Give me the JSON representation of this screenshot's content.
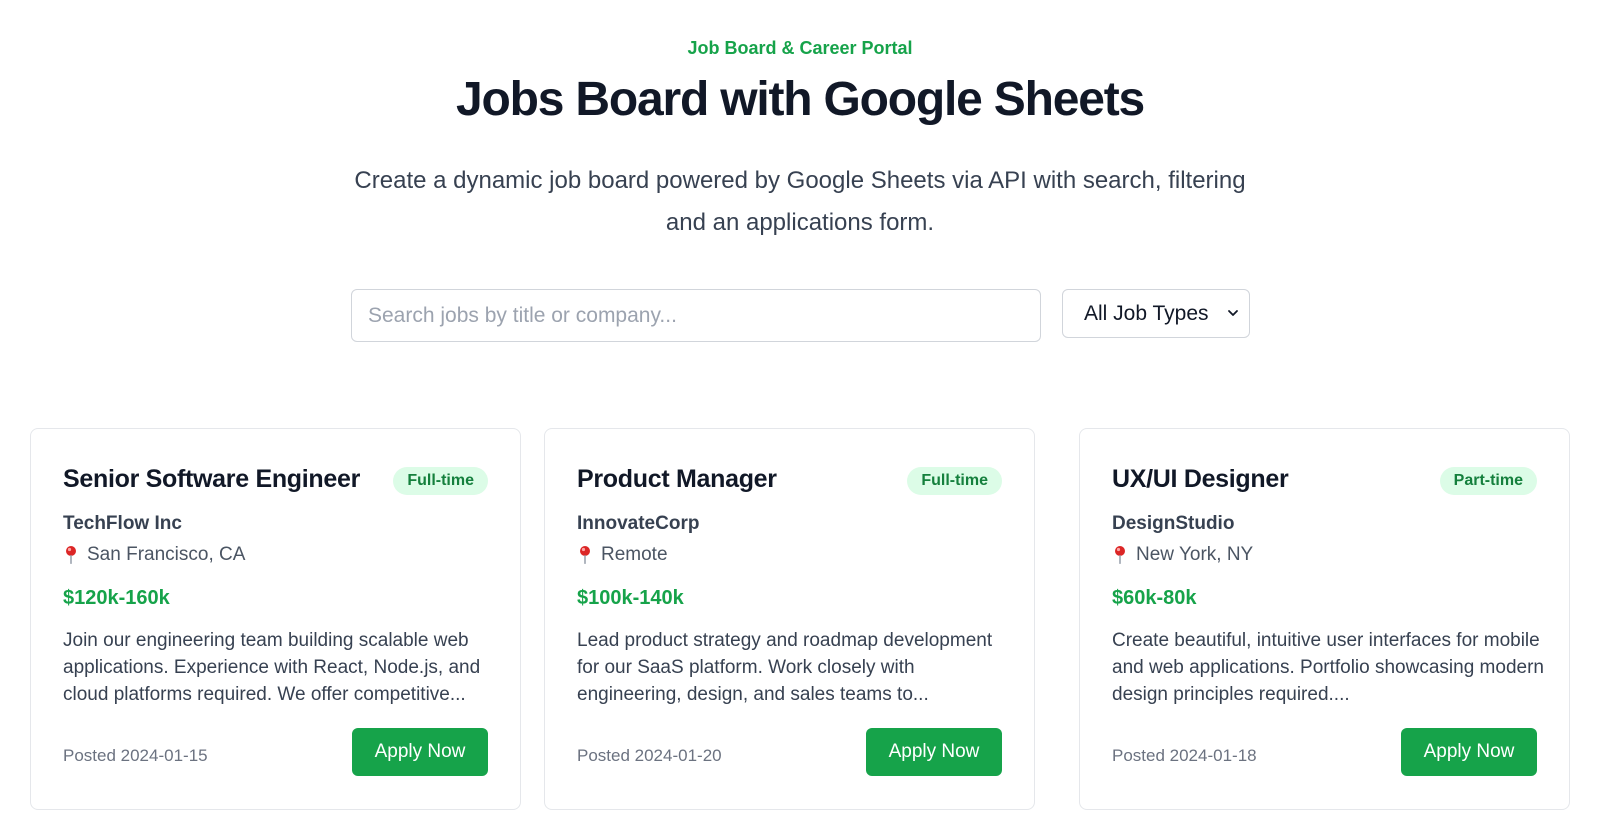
{
  "header": {
    "eyebrow": "Job Board & Career Portal",
    "title": "Jobs Board with Google Sheets",
    "subtitle": "Create a dynamic job board powered by Google Sheets via API with search, filtering and an applications form."
  },
  "filters": {
    "search_placeholder": "Search jobs by title or company...",
    "search_value": "",
    "job_type_selected": "All Job Types"
  },
  "jobs": [
    {
      "title": "Senior Software Engineer",
      "type": "Full-time",
      "company": "TechFlow Inc",
      "location": "San Francisco, CA",
      "salary": "$120k-160k",
      "description": "Join our engineering team building scalable web applications. Experience with React, Node.js, and cloud platforms required. We offer competitive...",
      "posted": "Posted 2024-01-15",
      "apply_label": "Apply Now"
    },
    {
      "title": "Product Manager",
      "type": "Full-time",
      "company": "InnovateCorp",
      "location": "Remote",
      "salary": "$100k-140k",
      "description": "Lead product strategy and roadmap development for our SaaS platform. Work closely with engineering, design, and sales teams to...",
      "posted": "Posted 2024-01-20",
      "apply_label": "Apply Now"
    },
    {
      "title": "UX/UI Designer",
      "type": "Part-time",
      "company": "DesignStudio",
      "location": "New York, NY",
      "salary": "$60k-80k",
      "description": "Create beautiful, intuitive user interfaces for mobile and web applications. Portfolio showcasing modern design principles required....",
      "posted": "Posted 2024-01-18",
      "apply_label": "Apply Now"
    }
  ],
  "icons": {
    "location": "map-pin-icon",
    "dropdown": "chevron-down-icon"
  },
  "colors": {
    "accent": "#16a34a",
    "badge_bg": "#dcfce7",
    "pin": "#dc2626"
  }
}
